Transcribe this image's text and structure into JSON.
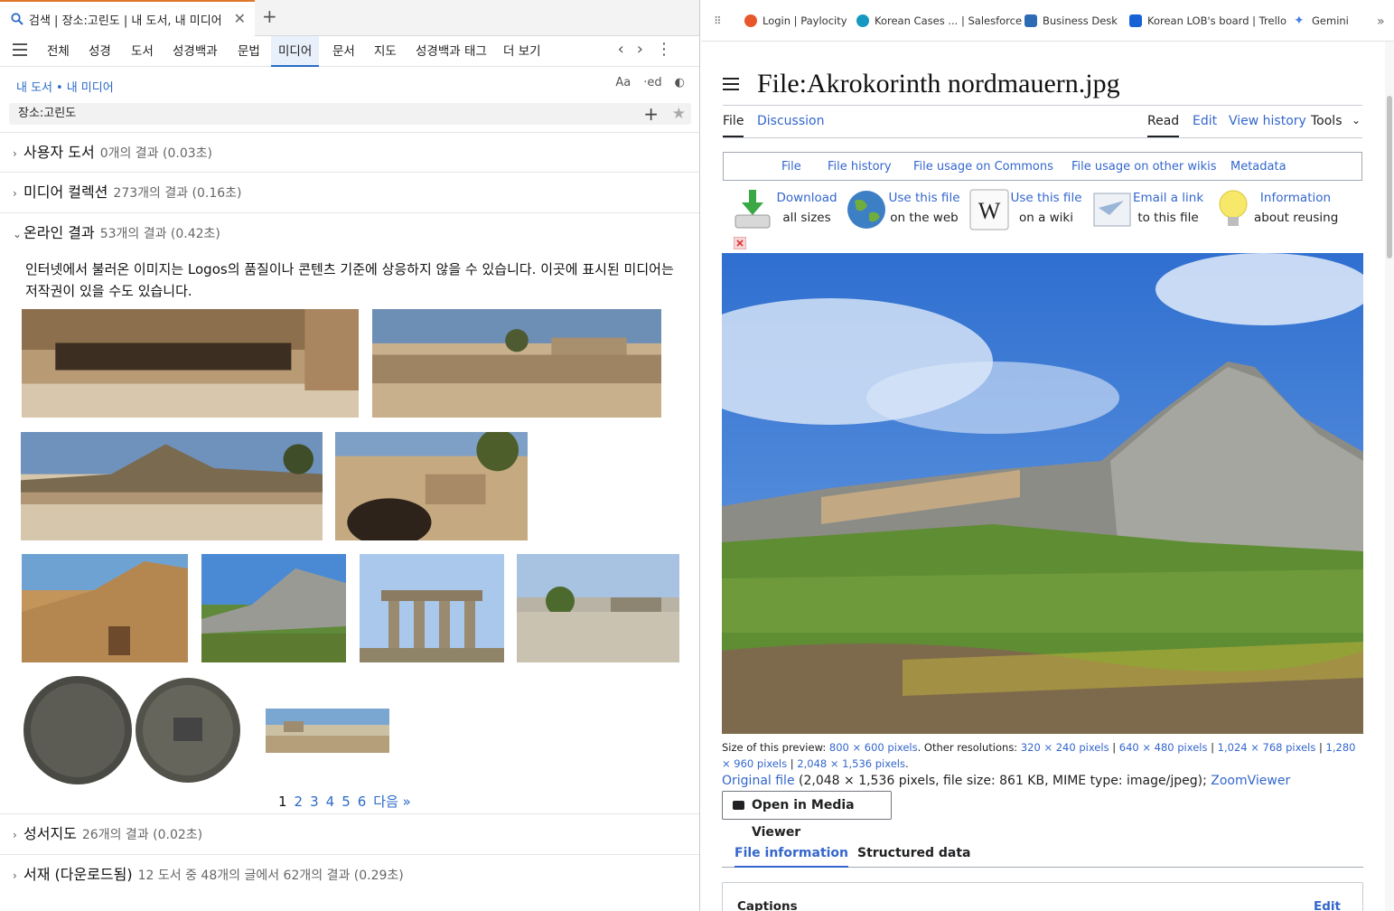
{
  "left": {
    "tab": {
      "title": "검색 | 장소:고린도 | 내 도서, 내 미디어"
    },
    "nav": [
      "전체",
      "성경",
      "도서",
      "성경백과",
      "문법",
      "미디어",
      "문서",
      "지도",
      "성경백과 태그",
      "더 보기"
    ],
    "nav_active": "미디어",
    "breadcrumb": {
      "a": "내 도서",
      "sep": "•",
      "b": "내 미디어"
    },
    "tools": {
      "font": "Aa",
      "ed": "·ed"
    },
    "search": {
      "query": "장소:고린도"
    },
    "sections": [
      {
        "name": "사용자 도서",
        "meta": "0개의 결과 (0.03초)"
      },
      {
        "name": "미디어 컬렉션",
        "meta": "273개의 결과 (0.16초)"
      },
      {
        "name": "온라인 결과",
        "meta": "53개의 결과 (0.42초)"
      },
      {
        "name": "성서지도",
        "meta": "26개의 결과 (0.02초)"
      },
      {
        "name": "서재 (다운로드됨)",
        "meta": "12 도서 중 48개의 글에서 62개의 결과 (0.29초)"
      }
    ],
    "notice": "인터넷에서 불러온 이미지는 Logos의 품질이나 콘텐츠 기준에 상응하지 않을 수 있습니다. 이곳에 표시된 미디어는 저작권이 있을 수도 있습니다.",
    "pager": {
      "pages": [
        "1",
        "2",
        "3",
        "4",
        "5",
        "6"
      ],
      "next": "다음 »"
    }
  },
  "right": {
    "bookmarks": [
      {
        "label": "Login | Paylocity",
        "color": "#e8572b"
      },
      {
        "label": "Korean Cases ... | Salesforce",
        "color": "#1798c1"
      },
      {
        "label": "Business Desk",
        "color": "#2d6cb5"
      },
      {
        "label": "Korean LOB's board | Trello",
        "color": "#1763d6"
      },
      {
        "label": "Gemini",
        "color": "#4a7fe8"
      }
    ],
    "title": "File:Akrokorinth nordmauern.jpg",
    "tabs": {
      "file": "File",
      "discussion": "Discussion",
      "read": "Read",
      "edit": "Edit",
      "history": "View history",
      "tools": "Tools"
    },
    "filenav": [
      "File",
      "File history",
      "File usage on Commons",
      "File usage on other wikis",
      "Metadata"
    ],
    "actions": [
      {
        "link": "Download",
        "text": "all sizes"
      },
      {
        "link": "Use this file",
        "text": "on the web"
      },
      {
        "link": "Use this file",
        "text": "on a wiki"
      },
      {
        "link": "Email a link",
        "text": "to this file"
      },
      {
        "link": "Information",
        "text": "about reusing"
      }
    ],
    "size": {
      "prefix": "Size of this preview:",
      "preview": "800 × 600 pixels",
      "other": ". Other resolutions:",
      "r1": "320 × 240 pixels",
      "r2": "640 × 480 pixels",
      "r3": "1,024 × 768 pixels",
      "r4": "1,280 × 960 pixels",
      "r5": "2,048 × 1,536 pixels"
    },
    "original": {
      "link": "Original file",
      "text": "(2,048 × 1,536 pixels, file size: 861 KB, MIME type: image/jpeg);",
      "zoom": "ZoomViewer"
    },
    "media_viewer": "Open in Media Viewer",
    "info_tabs": {
      "info": "File information",
      "structured": "Structured data"
    },
    "captions": {
      "title": "Captions",
      "edit": "Edit"
    }
  }
}
